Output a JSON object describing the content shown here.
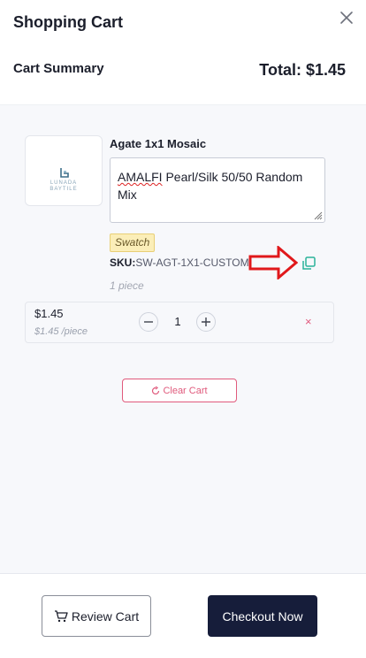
{
  "header": {
    "title": "Shopping Cart",
    "summary_label": "Cart Summary",
    "total": "Total: $1.45"
  },
  "item": {
    "name": "Agate 1x1 Mosaic",
    "logo_text_top": "LUNADA",
    "logo_text_bottom": "BAYTILE",
    "note_word": "AMALFI",
    "note_rest": " Pearl/Silk 50/50 Random Mix",
    "badge": "Swatch",
    "sku_label": "SKU:",
    "sku_value": "SW-AGT-1X1-CUSTOM",
    "pieces": "1 piece",
    "price": "$1.45",
    "unit_price": "$1.45 /piece",
    "quantity": "1",
    "remove_symbol": "×"
  },
  "actions": {
    "clear_cart": "Clear Cart",
    "review_cart": "Review Cart",
    "checkout": "Checkout Now"
  },
  "icons": {
    "close": "close-icon",
    "copy": "copy-icon",
    "arrow": "arrow-right-icon",
    "minus": "minus-icon",
    "plus": "plus-icon",
    "refresh": "refresh-icon",
    "cart": "cart-icon"
  },
  "colors": {
    "brand_dark": "#161d3a",
    "danger": "#e05a7c",
    "copy_teal": "#2bb39a",
    "annotation_red": "#e0181b",
    "badge_bg": "#fbeeb8"
  }
}
